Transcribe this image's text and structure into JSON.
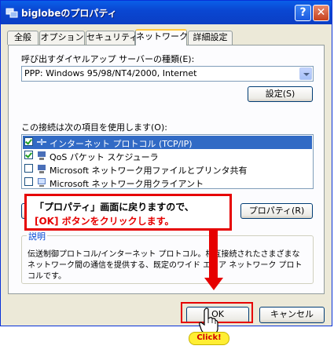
{
  "window": {
    "title": "biglobeのプロパティ",
    "help_label": "?",
    "close_label": "✕"
  },
  "tabs": [
    {
      "label": "全般",
      "active": false
    },
    {
      "label": "オプション",
      "active": false
    },
    {
      "label": "セキュリティ",
      "active": false
    },
    {
      "label": "ネットワーク",
      "active": true
    },
    {
      "label": "詳細設定",
      "active": false
    }
  ],
  "dialup": {
    "label": "呼び出すダイヤルアップ サーバーの種類(E):",
    "selected": "PPP: Windows 95/98/NT4/2000, Internet",
    "settings_button": "設定(S)"
  },
  "components": {
    "label": "この接続は次の項目を使用します(O):",
    "items": [
      {
        "label": "インターネット プロトコル (TCP/IP)",
        "checked": true,
        "selected": true,
        "icon": "network-protocol-icon"
      },
      {
        "label": "QoS パケット スケジューラ",
        "checked": true,
        "selected": false,
        "icon": "service-icon"
      },
      {
        "label": "Microsoft ネットワーク用ファイルとプリンタ共有",
        "checked": false,
        "selected": false,
        "icon": "file-printer-share-icon"
      },
      {
        "label": "Microsoft ネットワーク用クライアント",
        "checked": false,
        "selected": false,
        "icon": "network-client-icon"
      }
    ],
    "properties_button": "プロパティ(R)"
  },
  "description": {
    "title": "説明",
    "text_line1": "伝送制御プロトコル/インターネット プロトコル。相互接続されたさまざまな",
    "text_line2": "ネットワーク間の通信を提供する、既定のワイド エリア ネットワーク プロト",
    "text_line3": "コルです。"
  },
  "buttons": {
    "ok": "OK",
    "cancel": "キャンセル"
  },
  "annotation": {
    "line1": "「プロパティ」画面に戻りますので、",
    "line2": "[OK] ボタンをクリックします。",
    "click_label": "Click!",
    "accent_color": "#e60000"
  }
}
